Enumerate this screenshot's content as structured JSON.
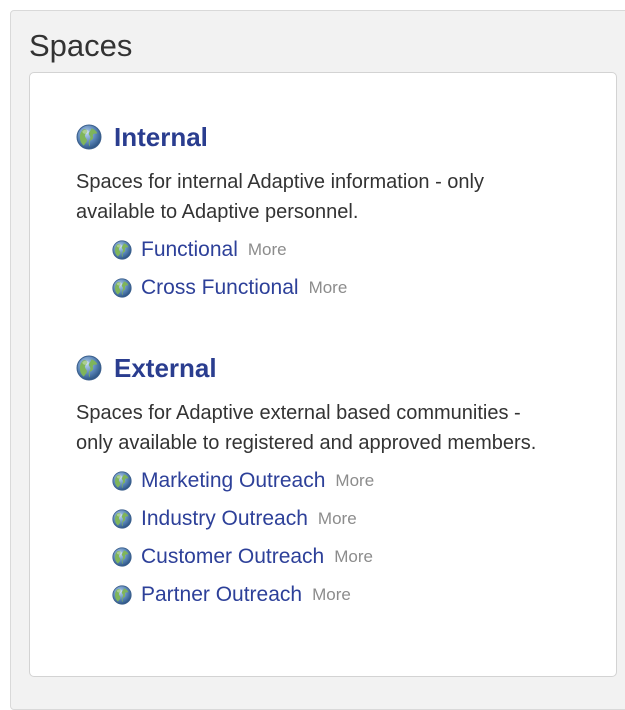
{
  "widget": {
    "title": "Spaces"
  },
  "groups": [
    {
      "title": "Internal",
      "icon": "globe-icon",
      "description": "Spaces for internal Adaptive information - only available to Adaptive personnel.",
      "items": [
        {
          "label": "Functional",
          "more": "More",
          "icon": "globe-icon"
        },
        {
          "label": "Cross Functional",
          "more": "More",
          "icon": "globe-icon"
        }
      ]
    },
    {
      "title": "External",
      "icon": "globe-icon",
      "description": "Spaces for Adaptive external based communities - only available to registered and approved members.",
      "items": [
        {
          "label": "Marketing Outreach",
          "more": "More",
          "icon": "globe-icon"
        },
        {
          "label": "Industry Outreach",
          "more": "More",
          "icon": "globe-icon"
        },
        {
          "label": "Customer Outreach",
          "more": "More",
          "icon": "globe-icon"
        },
        {
          "label": "Partner Outreach",
          "more": "More",
          "icon": "globe-icon"
        }
      ]
    }
  ],
  "colors": {
    "title_link": "#2a3d8f",
    "item_link": "#2d4099",
    "more_link": "#8c8c8c",
    "globe_blue": "#5b86b8",
    "globe_green": "#6aa84f"
  }
}
